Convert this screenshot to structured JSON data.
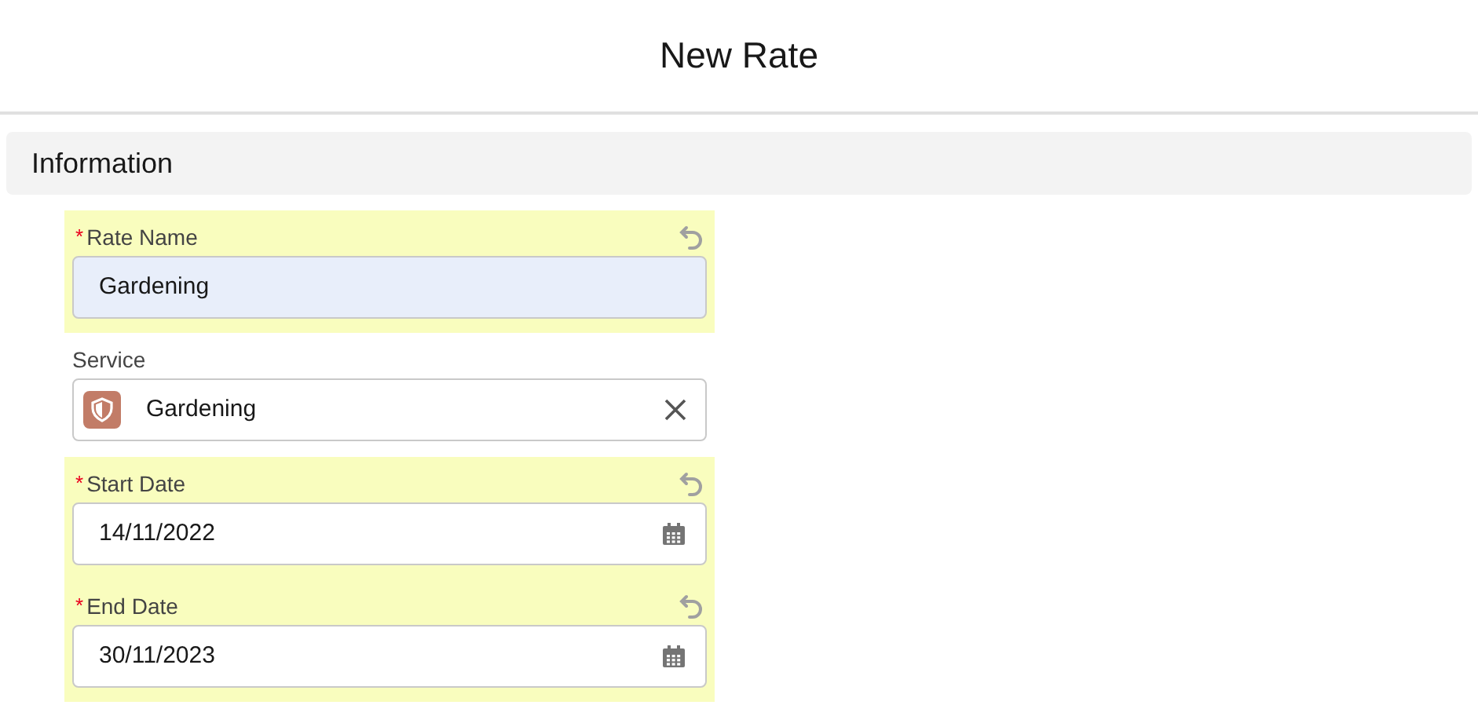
{
  "title": "New Rate",
  "section": {
    "title": "Information"
  },
  "fields": [
    {
      "kind": "text",
      "label": "Rate Name",
      "required_mark": "*",
      "edited": true,
      "focused": true,
      "value": "Gardening"
    },
    {
      "kind": "lookup",
      "label": "Service",
      "edited": false,
      "focused": false,
      "value": "Gardening"
    },
    {
      "kind": "date",
      "label": "Start Date",
      "required_mark": "*",
      "edited": true,
      "focused": false,
      "value": "14/11/2022"
    },
    {
      "kind": "date",
      "label": "End Date",
      "required_mark": "*",
      "edited": true,
      "focused": false,
      "value": "30/11/2023"
    }
  ]
}
